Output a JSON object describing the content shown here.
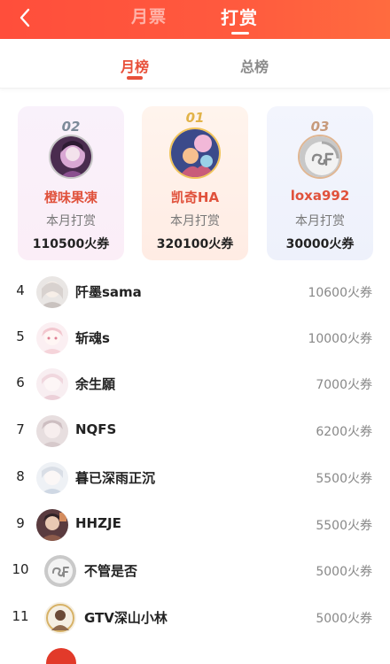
{
  "header": {
    "tab_ticket": "月票",
    "tab_reward": "打赏"
  },
  "subtabs": {
    "monthly": "月榜",
    "total": "总榜"
  },
  "podium": [
    {
      "rank": "02",
      "name": "橙味果凍",
      "label": "本月打赏",
      "amount": "110500火券"
    },
    {
      "rank": "01",
      "name": "凯奇HA",
      "label": "本月打赏",
      "amount": "320100火券"
    },
    {
      "rank": "03",
      "name": "loxa992",
      "label": "本月打赏",
      "amount": "30000火券"
    }
  ],
  "list": [
    {
      "rank": "4",
      "name": "阡墨sama",
      "amount": "10600火券"
    },
    {
      "rank": "5",
      "name": "斩魂s",
      "amount": "10000火券"
    },
    {
      "rank": "6",
      "name": "余生願",
      "amount": "7000火券"
    },
    {
      "rank": "7",
      "name": "NQFS",
      "amount": "6200火券"
    },
    {
      "rank": "8",
      "name": "暮已深雨正沉",
      "amount": "5500火券"
    },
    {
      "rank": "9",
      "name": "HHZJE",
      "amount": "5500火券"
    },
    {
      "rank": "10",
      "name": "不管是否",
      "amount": "5000火券"
    },
    {
      "rank": "11",
      "name": "GTV深山小林",
      "amount": "5000火券"
    }
  ],
  "colors": {
    "accent": "#e8503a",
    "header": "#ff4e3b"
  }
}
